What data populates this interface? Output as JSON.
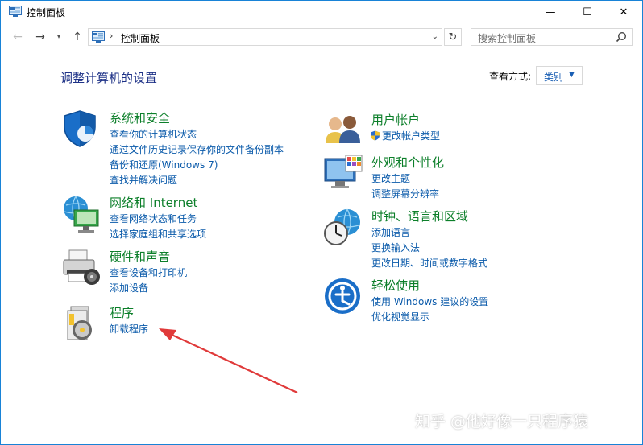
{
  "window": {
    "title": "控制面板",
    "min_glyph": "—",
    "max_glyph": "☐",
    "close_glyph": "✕"
  },
  "nav": {
    "back_glyph": "←",
    "forward_glyph": "→",
    "up_glyph": "↑",
    "path_sep": "›",
    "path": "控制面板",
    "search_placeholder": "搜索控制面板"
  },
  "main": {
    "heading": "调整计算机的设置",
    "view_by_label": "查看方式:",
    "view_by_value": "类别"
  },
  "left_categories": [
    {
      "title": "系统和安全",
      "icon": "shield-icon",
      "links": [
        "查看你的计算机状态",
        "通过文件历史记录保存你的文件备份副本",
        "备份和还原(Windows 7)",
        "查找并解决问题"
      ]
    },
    {
      "title": "网络和 Internet",
      "icon": "globe-network-icon",
      "links": [
        "查看网络状态和任务",
        "选择家庭组和共享选项"
      ]
    },
    {
      "title": "硬件和声音",
      "icon": "printer-icon",
      "links": [
        "查看设备和打印机",
        "添加设备"
      ]
    },
    {
      "title": "程序",
      "icon": "program-disc-icon",
      "links": [
        "卸载程序"
      ]
    }
  ],
  "right_categories": [
    {
      "title": "用户帐户",
      "icon": "users-icon",
      "links": [
        "更改帐户类型"
      ]
    },
    {
      "title": "外观和个性化",
      "icon": "monitor-palette-icon",
      "links": [
        "更改主题",
        "调整屏幕分辨率"
      ]
    },
    {
      "title": "时钟、语言和区域",
      "icon": "clock-globe-icon",
      "links": [
        "添加语言",
        "更换输入法",
        "更改日期、时间或数字格式"
      ]
    },
    {
      "title": "轻松使用",
      "icon": "ease-of-access-icon",
      "links": [
        "使用 Windows 建议的设置",
        "优化视觉显示"
      ]
    }
  ],
  "watermark": "知乎 @他好像一只程序猿",
  "colors": {
    "accent": "#1883d7",
    "category_title": "#0c7f2a",
    "link": "#0a5aaa",
    "heading": "#1e3287",
    "annotation_arrow": "#e03a3a"
  }
}
